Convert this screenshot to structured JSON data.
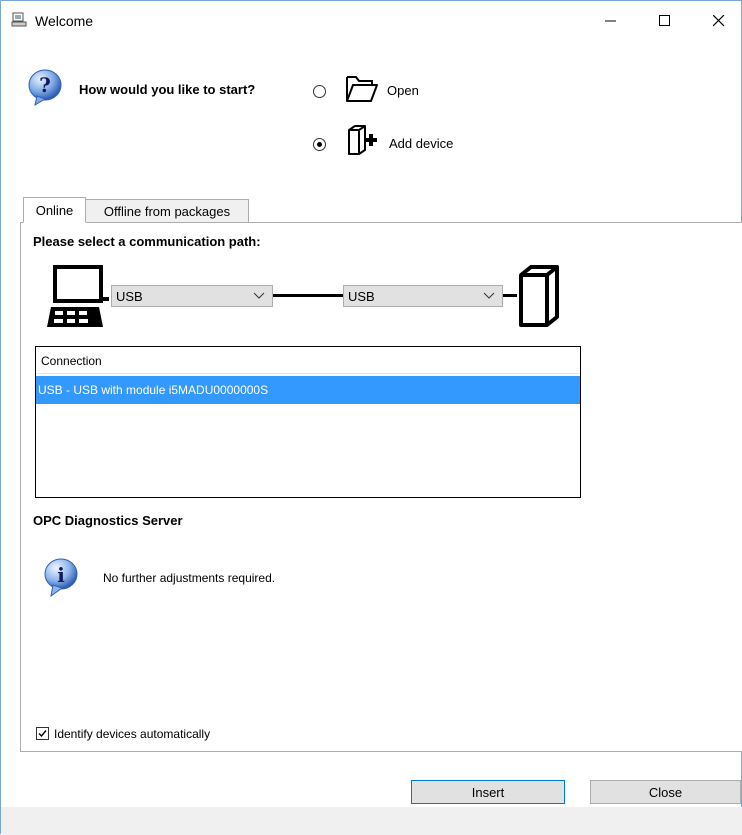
{
  "window": {
    "title": "Welcome",
    "controls": [
      "minimize",
      "maximize",
      "close"
    ]
  },
  "start": {
    "question": "How would you like to start?",
    "options": [
      {
        "label": "Open",
        "selected": false,
        "icon": "folder-open-icon"
      },
      {
        "label": "Add device",
        "selected": true,
        "icon": "add-device-icon"
      }
    ]
  },
  "tabs": [
    {
      "label": "Online",
      "active": true
    },
    {
      "label": "Offline from packages",
      "active": false
    }
  ],
  "online": {
    "path_title": "Please select a communication path:",
    "combo_left": "USB",
    "combo_right": "USB",
    "list": {
      "header": "Connection",
      "rows": [
        "USB - USB with module i5MADU0000000S"
      ],
      "selected_index": 0
    },
    "opc_title": "OPC Diagnostics Server",
    "opc_info": "No further adjustments required.",
    "identify_label": "Identify devices automatically",
    "identify_checked": true
  },
  "buttons": {
    "insert": "Insert",
    "close": "Close"
  },
  "colors": {
    "selection": "#3399ff",
    "accent_border": "#0078d7",
    "help_icon": "#2f6fc0"
  }
}
